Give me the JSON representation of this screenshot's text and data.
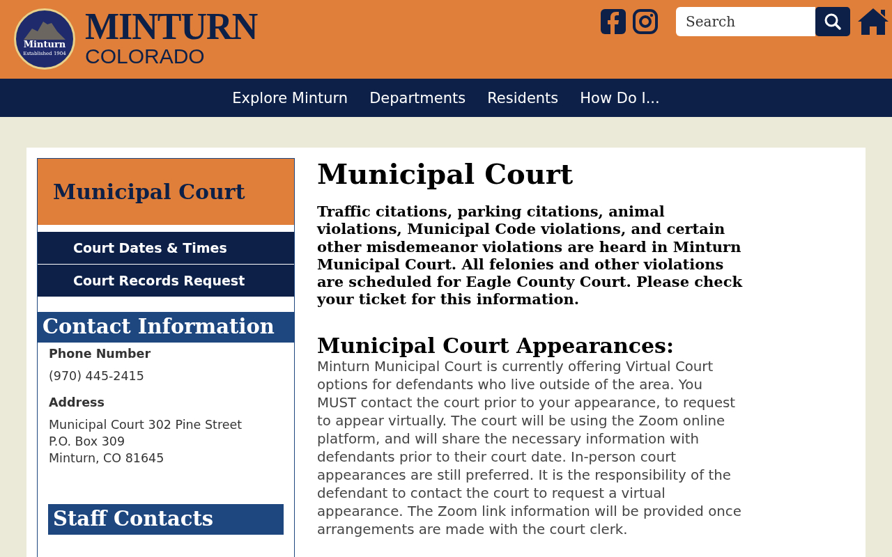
{
  "header": {
    "logo_badge": {
      "name": "Minturn",
      "tagline": "Established 1904"
    },
    "site_name": "MINTURN",
    "site_subtitle": "COLORADO",
    "search": {
      "placeholder": "Search"
    }
  },
  "nav": [
    "Explore Minturn",
    "Departments",
    "Residents",
    "How Do I..."
  ],
  "sidebar": {
    "title": "Municipal Court",
    "links": [
      {
        "label": "Court Dates & Times"
      },
      {
        "label": "Court Records Request"
      }
    ],
    "contact": {
      "heading": "Contact Information",
      "fields": [
        {
          "label": "Phone Number",
          "lines": [
            "(970) 445-2415"
          ]
        },
        {
          "label": "Address",
          "lines": [
            "Municipal Court 302 Pine Street",
            "P.O. Box 309",
            "Minturn, CO 81645"
          ]
        }
      ]
    },
    "staff_heading": "Staff Contacts"
  },
  "main": {
    "title": "Municipal Court",
    "intro": "Traffic citations, parking citations, animal violations, Municipal Code violations, and certain other misdemeanor violations are heard in Minturn Municipal Court. All felonies and other violations are scheduled for Eagle County Court. Please check your ticket for this information.",
    "section_heading": "Municipal Court Appearances:",
    "section_text": "Minturn Municipal Court is currently offering Virtual Court options for defendants who live outside of the area.  You MUST contact the court prior to your appearance, to request to appear virtually. The court will be using the Zoom online platform, and will share the necessary information with defendants prior to their court date.  In-person court appearances are still preferred. It is the responsibility of the defendant to contact the court to request a virtual appearance.  The Zoom link information will be provided once arrangements are made with the court clerk."
  }
}
